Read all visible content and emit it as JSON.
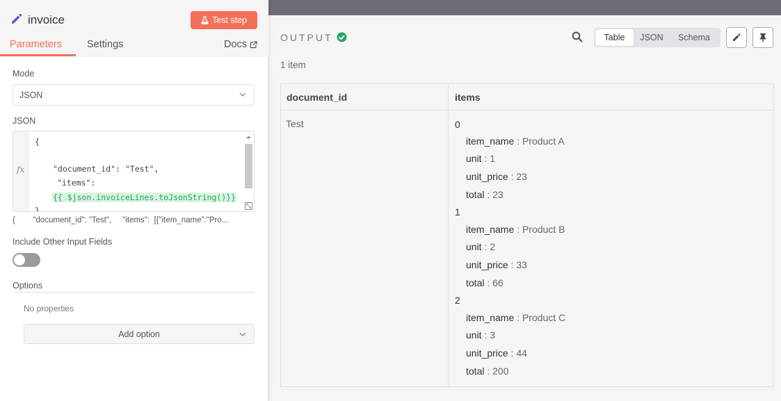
{
  "node": {
    "title": "invoice",
    "test_button": "Test step",
    "tabs": [
      "Parameters",
      "Settings"
    ],
    "docs_link": "Docs"
  },
  "parameters": {
    "mode_label": "Mode",
    "mode_value": "JSON",
    "json_label": "JSON",
    "json_lines": [
      "{",
      "\"document_id\": \"Test\",",
      "\"items\":",
      "{{ $json.invoiceLines.toJsonString()}}",
      "}"
    ],
    "json_preview": "{        \"document_id\": \"Test\",     \"items\":  [{\"item_name\":\"Pro...",
    "include_other_label": "Include Other Input Fields",
    "include_other_enabled": false,
    "options_label": "Options",
    "no_properties": "No properties",
    "add_option": "Add option"
  },
  "output": {
    "title": "OUTPUT",
    "view_modes": [
      "Table",
      "JSON",
      "Schema"
    ],
    "active_view": "Table",
    "item_count": "1 item",
    "columns": [
      "document_id",
      "items"
    ],
    "row": {
      "document_id": "Test",
      "items": [
        {
          "index": "0",
          "item_name": "Product A",
          "unit": "1",
          "unit_price": "23",
          "total": "23"
        },
        {
          "index": "1",
          "item_name": "Product B",
          "unit": "2",
          "unit_price": "33",
          "total": "66"
        },
        {
          "index": "2",
          "item_name": "Product C",
          "unit": "3",
          "unit_price": "44",
          "total": "200"
        }
      ]
    },
    "keys": {
      "item_name": "item_name",
      "unit": "unit",
      "unit_price": "unit_price",
      "total": "total"
    },
    "separator": " : "
  },
  "colors": {
    "accent": "#f27057",
    "success": "#29a568",
    "topbar": "#6e6c78",
    "expression_bg": "#d8f5e1"
  },
  "icons": [
    "pencil-icon",
    "flask-icon",
    "external-link-icon",
    "chevron-down-icon",
    "check-circle-icon",
    "search-icon",
    "edit-icon",
    "pin-icon"
  ]
}
